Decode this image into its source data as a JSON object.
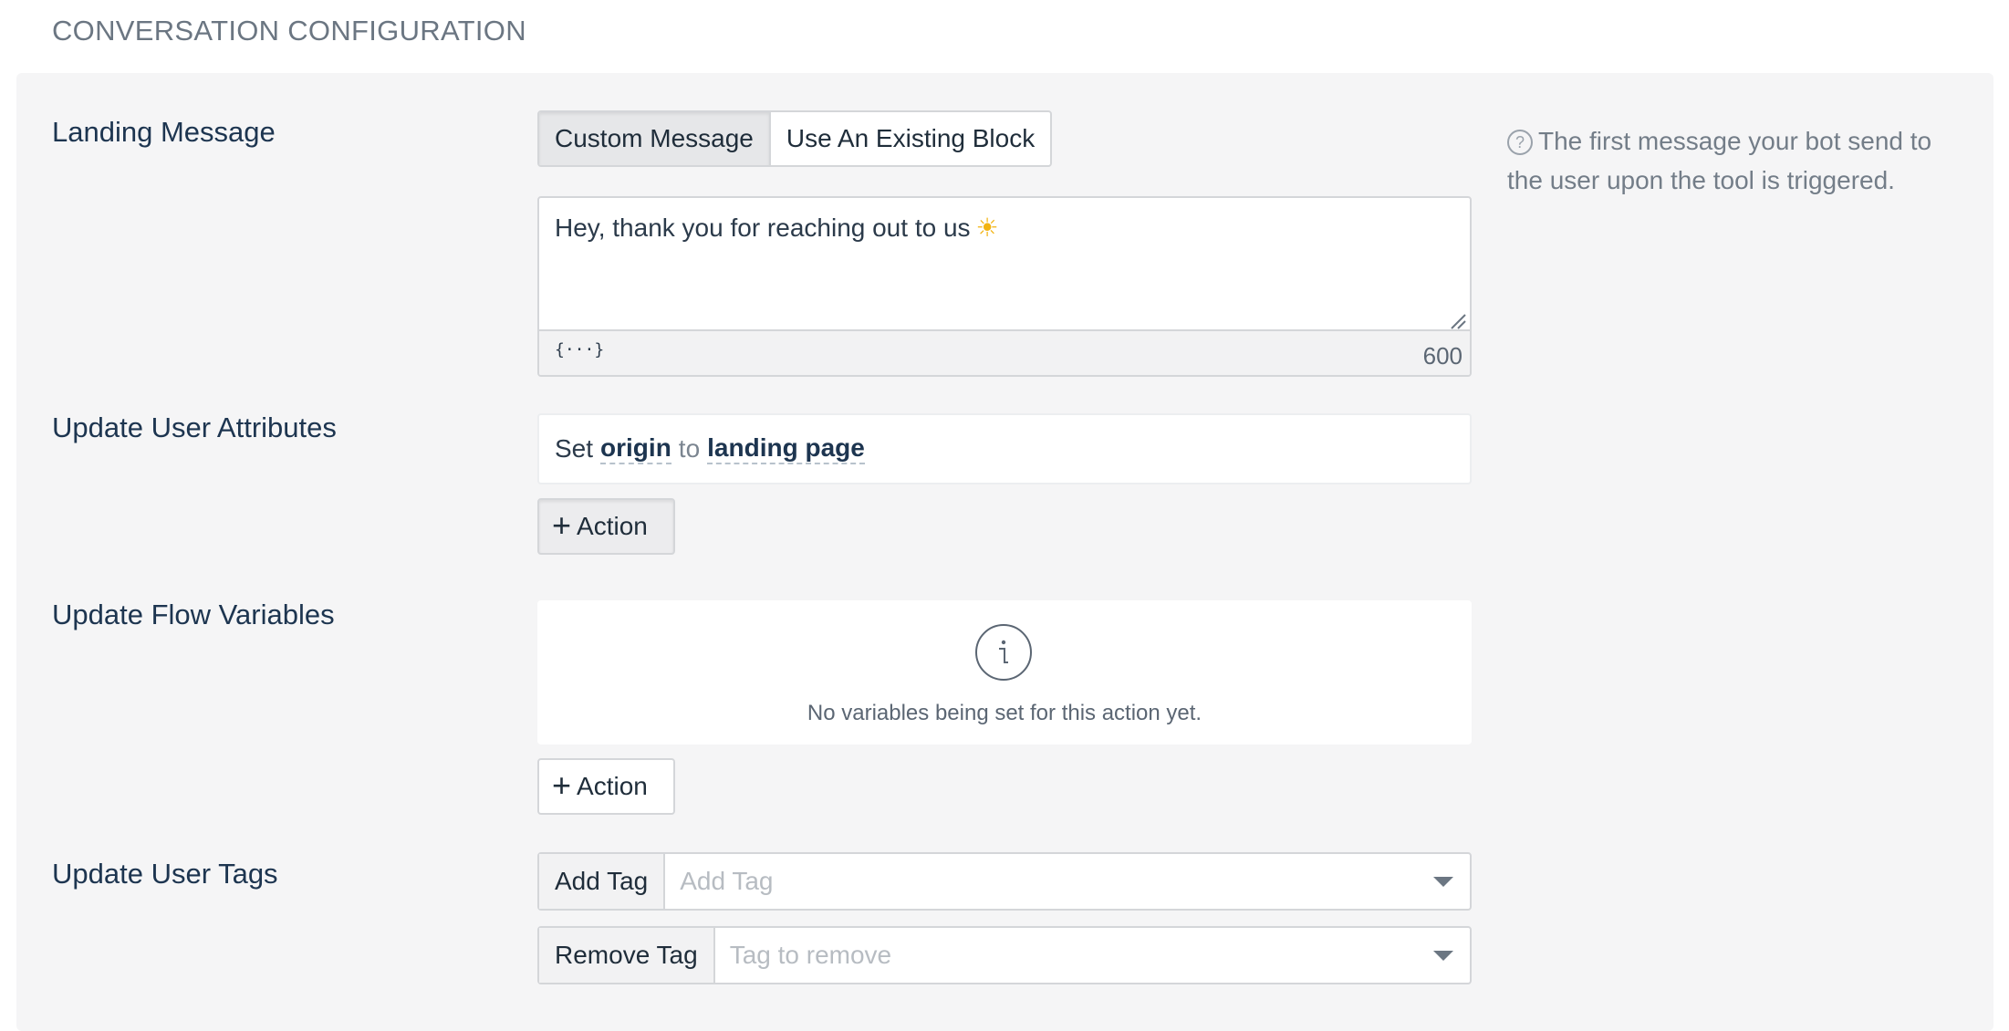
{
  "section_title": "CONVERSATION CONFIGURATION",
  "landing_message": {
    "label": "Landing Message",
    "options": [
      "Custom Message",
      "Use An Existing Block"
    ],
    "selected": "Custom Message",
    "message_text": "Hey, thank you for reaching out to us",
    "emoji": "☀",
    "variable_icon": "{···}",
    "char_count": "600",
    "help_text": "The first message your bot send to the user upon the tool is triggered."
  },
  "user_attributes": {
    "label": "Update User Attributes",
    "set_word": "Set",
    "attribute": "origin",
    "to_word": "to",
    "value": "landing page",
    "action_label": "Action"
  },
  "flow_variables": {
    "label": "Update Flow Variables",
    "empty_text": "No variables being set for this action yet.",
    "action_label": "Action"
  },
  "user_tags": {
    "label": "Update User Tags",
    "add_label": "Add Tag",
    "add_placeholder": "Add Tag",
    "remove_label": "Remove Tag",
    "remove_placeholder": "Tag to remove"
  },
  "icons": {
    "help": "question-circle-icon",
    "info": "info-circle-icon",
    "plus": "plus-icon",
    "dropdown": "caret-down-icon",
    "emoji": "sun-emoji-icon",
    "variables": "variable-braces-icon"
  }
}
